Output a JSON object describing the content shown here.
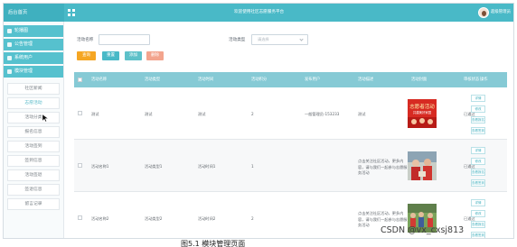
{
  "header": {
    "brand": "后台首页",
    "title": "欢迎使用社区志愿服务平台",
    "user": "超级管理员"
  },
  "sidebar": {
    "menus": [
      "轮播图",
      "公告管理",
      "系统用户",
      "模块管理"
    ],
    "sub_items": [
      "社区新闻",
      "志愿活动",
      "活动分类",
      "报名信息",
      "活动签到",
      "签到信息",
      "活动签退",
      "签退信息",
      "留言记录"
    ]
  },
  "filters": {
    "name_label": "活动名称",
    "type_label": "活动类型",
    "type_value": "请选择"
  },
  "buttons": [
    "查询",
    "重置",
    "添加",
    "删除"
  ],
  "colors": {
    "header": "#49b9c7",
    "accent": "#56c1ce",
    "search_button": "#f5a623",
    "reset_button": "#49b9c7",
    "add_button": "#5ec1c9",
    "delete_button": "#f3a48d"
  },
  "table": {
    "headers": [
      "活动名称",
      "活动类型",
      "活动时间",
      "活动积分",
      "发布用户",
      "活动描述",
      "活动封面",
      "审核状态",
      "操作"
    ],
    "rows": [
      {
        "name": "测试",
        "type": "测试",
        "time": "测试",
        "points": "2",
        "user": "一般管理员-153233",
        "desc": "测试",
        "status": "已通过",
        "cover": "red"
      },
      {
        "name": "活动名称1",
        "type": "活动类型1",
        "time": "活动时间1",
        "points": "1",
        "user": "",
        "desc": "点击关注社区活动，更多内容，请与我们一起参与志愿服务活动",
        "status": "已通过",
        "cover": "people"
      },
      {
        "name": "活动名称2",
        "type": "活动类型2",
        "time": "活动时间2",
        "points": "2",
        "user": "",
        "desc": "点击关注社区活动，更多内容，请与我们一起参与志愿服务活动",
        "status": "已通过",
        "cover": "group"
      }
    ],
    "actions": [
      "详情",
      "修改",
      "查看报名",
      "查看签到"
    ]
  },
  "cover_text": {
    "main": "志愿者活动",
    "sub": "共建美好家园"
  },
  "caption": "图5.1 模块管理页面",
  "watermark": "CSDN @vx_cxsj813"
}
